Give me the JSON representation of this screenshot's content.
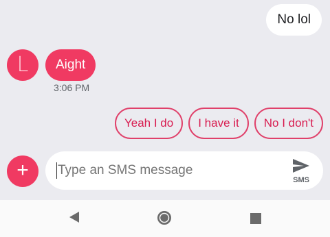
{
  "messages": {
    "outgoing": [
      {
        "text": "No lol"
      }
    ],
    "incoming": [
      {
        "sender_initial": "L",
        "text": "Aight",
        "time": "3:06 PM"
      }
    ]
  },
  "smart_replies": [
    "Yeah I do",
    "I have it",
    "No I don't"
  ],
  "compose": {
    "placeholder": "Type an SMS message",
    "add_label": "+",
    "send_icon": "send-icon",
    "send_label": "SMS"
  },
  "navbar": {
    "icons": [
      "back-icon",
      "home-icon",
      "recents-icon"
    ]
  },
  "colors": {
    "accent": "#f03a62",
    "chip_border": "#e0406a",
    "background": "#ebebf0"
  }
}
